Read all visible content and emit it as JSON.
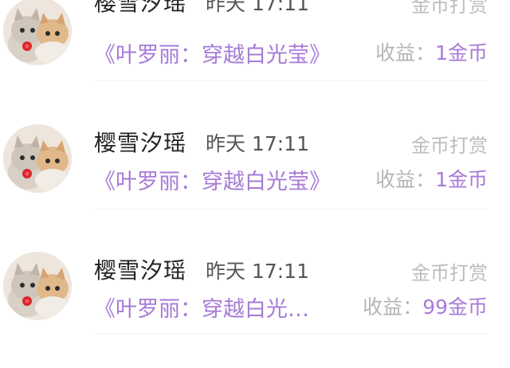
{
  "records": [
    {
      "username": "樱雪汐瑶",
      "time": "昨天  17:11",
      "reward_type": "金币打赏",
      "book_title": "《叶罗丽：穿越白光莹》",
      "income_label": "收益：",
      "income_value": "1金币"
    },
    {
      "username": "樱雪汐瑶",
      "time": "昨天  17:11",
      "reward_type": "金币打赏",
      "book_title": "《叶罗丽：穿越白光莹》",
      "income_label": "收益：",
      "income_value": "1金币"
    },
    {
      "username": "樱雪汐瑶",
      "time": "昨天  17:11",
      "reward_type": "金币打赏",
      "book_title": "《叶罗丽：穿越白光…",
      "income_label": "收益：",
      "income_value": "99金币"
    }
  ],
  "colors": {
    "accent": "#a77bd6",
    "muted": "#bdbdbd",
    "name": "#222222"
  },
  "icons": {
    "avatar": "cats-avatar"
  }
}
